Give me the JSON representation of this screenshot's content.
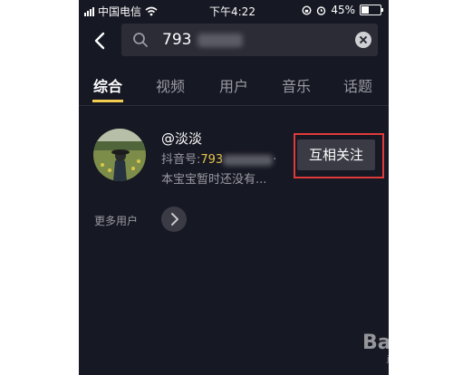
{
  "status_bar": {
    "carrier": "中国电信",
    "time": "下午4:22",
    "battery": "45%",
    "battery_level": 0.45
  },
  "search": {
    "query": "793"
  },
  "tabs": [
    {
      "label": "综合",
      "active": true
    },
    {
      "label": "视频",
      "active": false
    },
    {
      "label": "用户",
      "active": false
    },
    {
      "label": "音乐",
      "active": false
    },
    {
      "label": "话题",
      "active": false
    }
  ],
  "user_result": {
    "username": "@淡淡",
    "douyin_label": "抖音号:",
    "douyin_id": "793",
    "douyin_suffix": "·",
    "bio": "本宝宝暂时还没有...",
    "follow_button": "互相关注"
  },
  "more_users": {
    "label": "更多用户"
  },
  "watermark": {
    "text": "Bai",
    "sub": "jingyan.baidu.com"
  },
  "colors": {
    "background": "#161823",
    "accent": "#f2cd4f",
    "highlight_frame": "#e03a3a"
  }
}
